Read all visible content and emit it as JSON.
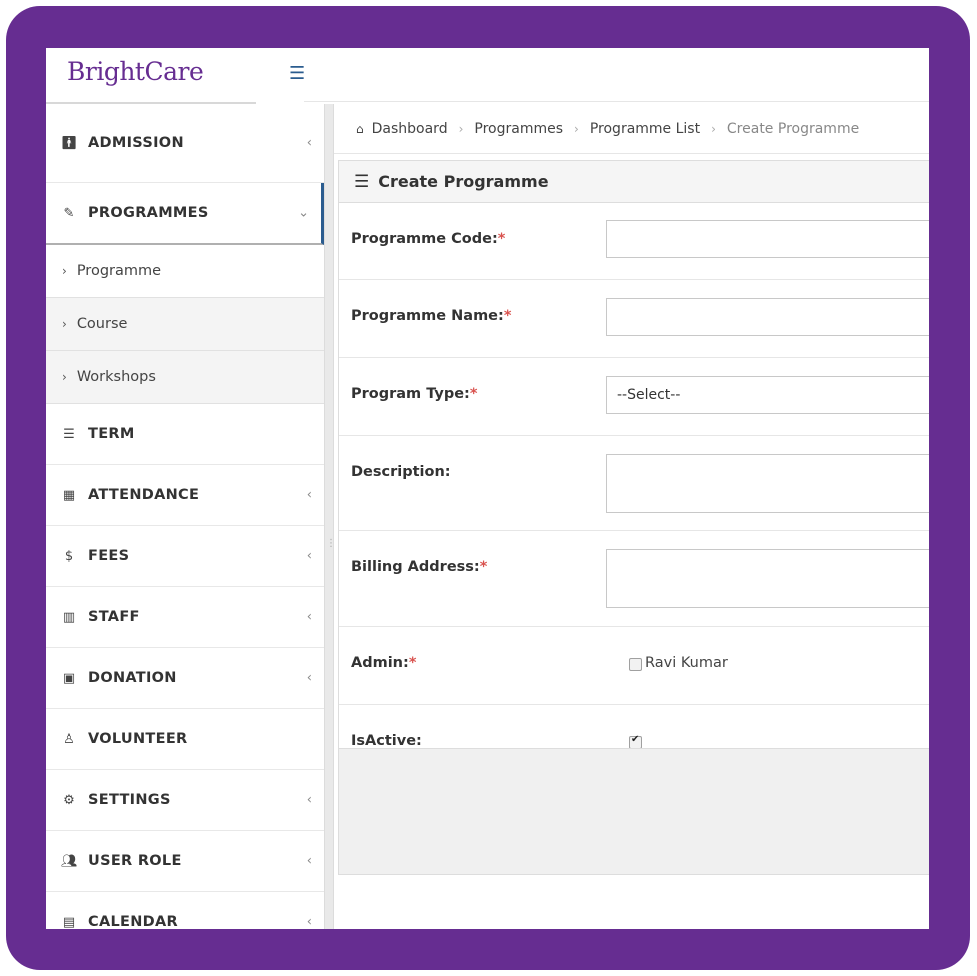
{
  "app": {
    "brand": "BrightCare",
    "menu_toggle_icon": "hamburger-icon",
    "accent": "#662d91",
    "link_color": "#2b5c8f",
    "required_color": "#d9534f"
  },
  "sidebar": {
    "items": [
      {
        "label": "ADMISSION",
        "icon": "person-icon",
        "chevron": "‹"
      },
      {
        "label": "PROGRAMMES",
        "icon": "edit-icon",
        "chevron": "⌄",
        "expanded": true,
        "children": [
          {
            "label": "Programme"
          },
          {
            "label": "Course"
          },
          {
            "label": "Workshops"
          }
        ]
      },
      {
        "label": "TERM",
        "icon": "list-icon"
      },
      {
        "label": "ATTENDANCE",
        "icon": "table-icon",
        "chevron": "‹"
      },
      {
        "label": "FEES",
        "icon": "dollar-icon",
        "chevron": "‹"
      },
      {
        "label": "STAFF",
        "icon": "bar-chart-icon",
        "chevron": "‹"
      },
      {
        "label": "DONATION",
        "icon": "money-icon",
        "chevron": "‹"
      },
      {
        "label": "VOLUNTEER",
        "icon": "user-tie-icon"
      },
      {
        "label": "SETTINGS",
        "icon": "cogs-icon",
        "chevron": "‹"
      },
      {
        "label": "USER ROLE",
        "icon": "users-icon",
        "chevron": "‹"
      },
      {
        "label": "CALENDAR",
        "icon": "calendar-icon",
        "chevron": "‹"
      }
    ]
  },
  "breadcrumb": {
    "items": [
      "Dashboard",
      "Programmes",
      "Programme List"
    ],
    "current": "Create Programme",
    "separator": "›"
  },
  "form": {
    "title": "Create Programme",
    "fields": {
      "code": {
        "label": "Programme Code:",
        "required": "*",
        "value": ""
      },
      "name": {
        "label": "Programme Name:",
        "required": "*",
        "value": ""
      },
      "type": {
        "label": "Program Type:",
        "required": "*",
        "selected": "--Select--"
      },
      "description": {
        "label": "Description:",
        "value": ""
      },
      "billing": {
        "label": "Billing Address:",
        "required": "*",
        "value": ""
      },
      "admin": {
        "label": "Admin:",
        "required": "*",
        "option": "Ravi Kumar",
        "checked": false
      },
      "active": {
        "label": "IsActive:",
        "checked": true
      }
    }
  }
}
